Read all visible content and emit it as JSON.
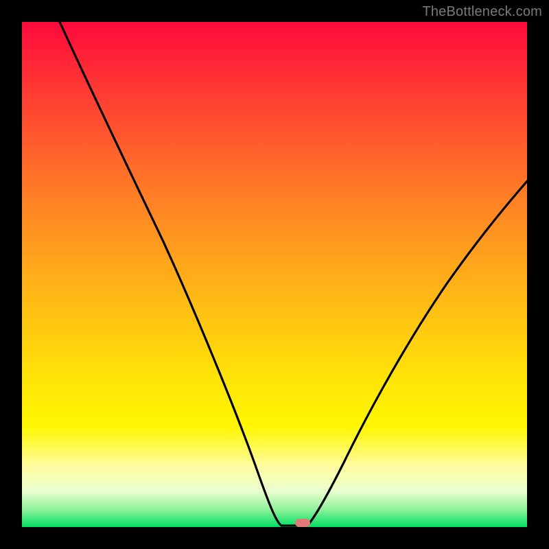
{
  "attribution": "TheBottleneck.com",
  "colors": {
    "frame": "#000000",
    "gradient_top": "#ff0a3c",
    "gradient_bottom": "#00e060",
    "curve": "#000000",
    "marker": "#e37a7a"
  },
  "chart_data": {
    "type": "line",
    "title": "",
    "xlabel": "",
    "ylabel": "",
    "xlim": [
      0,
      100
    ],
    "ylim": [
      0,
      100
    ],
    "x": [
      0,
      5,
      10,
      15,
      20,
      25,
      28,
      32,
      36,
      40,
      44,
      46,
      48,
      50,
      52,
      54,
      56,
      58,
      60,
      64,
      68,
      72,
      76,
      80,
      84,
      88,
      92,
      96,
      100
    ],
    "values": [
      100,
      91,
      82,
      73,
      64,
      55,
      50,
      43,
      35,
      27,
      18,
      12,
      6,
      2,
      0,
      0,
      0,
      2,
      6,
      15,
      24,
      32,
      39,
      46,
      52,
      57,
      62,
      66,
      70
    ],
    "marker": {
      "x": 55,
      "y": 0
    },
    "grid": false,
    "legend": false
  }
}
